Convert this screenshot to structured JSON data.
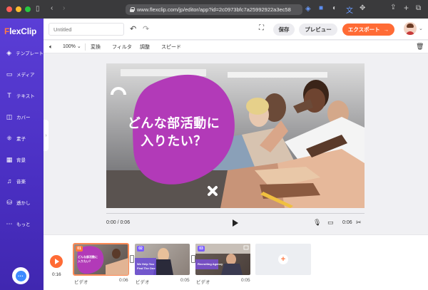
{
  "browser": {
    "url": "www.flexclip.com/jp/editor/app?id=2c0973bfc7a25992922a3ec58"
  },
  "sidebar": {
    "logo": "FlexClip",
    "items": [
      {
        "label": "テンプレート",
        "icon": "layers-icon"
      },
      {
        "label": "メディア",
        "icon": "media-folder-icon"
      },
      {
        "label": "テキスト",
        "icon": "text-icon"
      },
      {
        "label": "カバー",
        "icon": "cover-icon"
      },
      {
        "label": "素子",
        "icon": "elements-icon"
      },
      {
        "label": "背景",
        "icon": "background-icon"
      },
      {
        "label": "音楽",
        "icon": "music-icon"
      },
      {
        "label": "透かし",
        "icon": "watermark-icon"
      },
      {
        "label": "もっと",
        "icon": "more-icon"
      }
    ]
  },
  "topbar": {
    "title_placeholder": "Untitled",
    "save_label": "保存",
    "preview_label": "プレビュー",
    "export_label": "エクスポート",
    "export_arrow": "→"
  },
  "toolbar": {
    "zoom": "100%",
    "convert_label": "変換",
    "filter_label": "フィルタ",
    "adjust_label": "調整",
    "speed_label": "スピード"
  },
  "video": {
    "title_line1": "どんな部活動に",
    "title_line2": "入りたい？",
    "current_time": "0:00 / 0:06",
    "duration": "0:06"
  },
  "timeline": {
    "total_time": "0:16",
    "clips": [
      {
        "num": "01",
        "caption1": "どんな部活動に",
        "caption2": "入りたい？",
        "label": "ビデオ",
        "duration": "0:06",
        "num_color": "#ff7a3c"
      },
      {
        "num": "02",
        "caption1": "We Help You",
        "caption2": "Find The One",
        "label": "ビデオ",
        "duration": "0:05",
        "num_color": "#7a5cff"
      },
      {
        "num": "03",
        "caption1": "Recruiting Agency",
        "caption2": "",
        "label": "ビデオ",
        "duration": "0:05",
        "num_color": "#7a5cff"
      }
    ],
    "add_symbol": "+"
  },
  "colors": {
    "accent": "#ff6b35",
    "sidebar": "#5b3ed6",
    "blob": "#b23ab8"
  }
}
